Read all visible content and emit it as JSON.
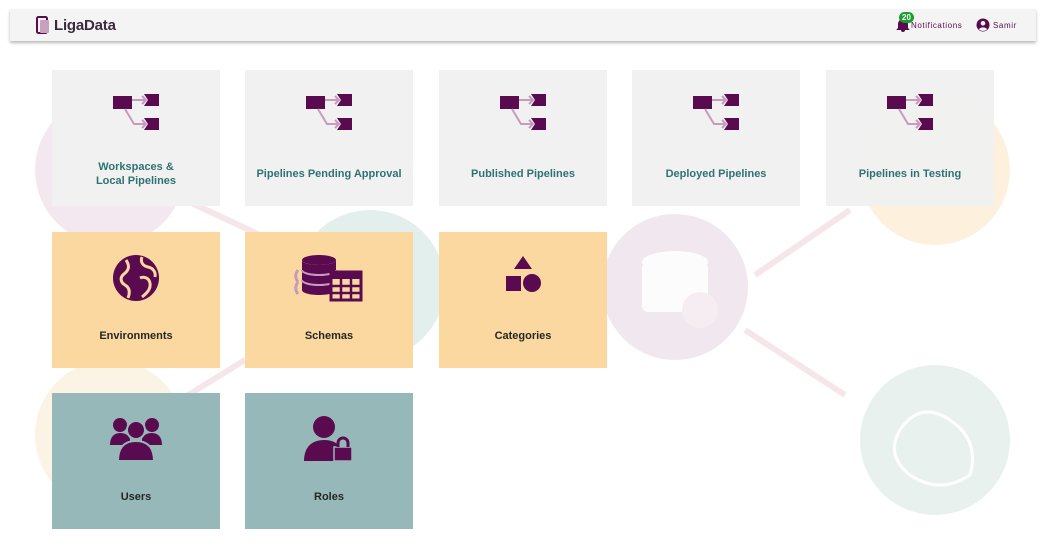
{
  "header": {
    "logo_text": "LigaData",
    "notifications_count": "20",
    "notifications_label": "Notifications",
    "user_name": "Samir"
  },
  "colors": {
    "brand": "#5a0a4f",
    "tile_gray": "#f1f1f1",
    "tile_orange": "#fcd8a1",
    "tile_teal": "#97b8b9",
    "label_teal": "#2e7371",
    "badge_green": "#1a9e2f"
  },
  "tiles": [
    {
      "label": "Workspaces &\nLocal Pipelines",
      "icon": "pipeline-icon"
    },
    {
      "label": "Pipelines Pending Approval",
      "icon": "pipeline-icon"
    },
    {
      "label": "Published Pipelines",
      "icon": "pipeline-icon"
    },
    {
      "label": "Deployed Pipelines",
      "icon": "pipeline-icon"
    },
    {
      "label": "Pipelines in Testing",
      "icon": "pipeline-icon"
    },
    {
      "label": "Environments",
      "icon": "globe-icon"
    },
    {
      "label": "Schemas",
      "icon": "database-table-icon"
    },
    {
      "label": "Categories",
      "icon": "shapes-icon"
    },
    {
      "label": "Users",
      "icon": "users-icon"
    },
    {
      "label": "Roles",
      "icon": "user-lock-icon"
    }
  ]
}
